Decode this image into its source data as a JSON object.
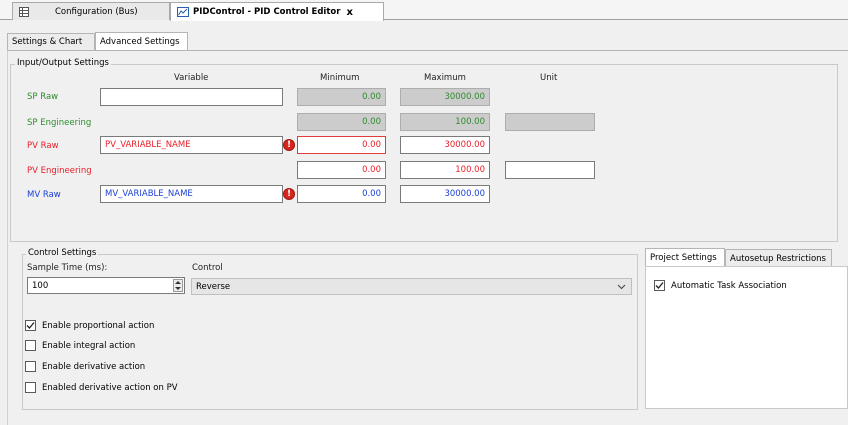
{
  "doc_tabs": [
    {
      "label": "Configuration (Bus)",
      "icon": "grid-config-icon"
    },
    {
      "label": "PIDControl - PID Control Editor",
      "icon": "pid-chart-icon",
      "close": "x"
    }
  ],
  "sub_tabs": [
    "Settings & Chart",
    "Advanced Settings"
  ],
  "io": {
    "title": "Input/Output Settings",
    "headers": {
      "variable": "Variable",
      "minimum": "Minimum",
      "maximum": "Maximum",
      "unit": "Unit"
    },
    "rows": [
      {
        "label": "SP Raw",
        "variable": "",
        "min": "0.00",
        "max": "30000.00",
        "unit": ""
      },
      {
        "label": "SP Engineering",
        "min": "0.00",
        "max": "100.00",
        "unit": ""
      },
      {
        "label": "PV Raw",
        "variable": "PV_VARIABLE_NAME",
        "min": "0.00",
        "max": "30000.00"
      },
      {
        "label": "PV Engineering",
        "min": "0.00",
        "max": "100.00",
        "unit": ""
      },
      {
        "label": "MV Raw",
        "variable": "MV_VARIABLE_NAME",
        "min": "0.00",
        "max": "30000.00"
      }
    ],
    "error_icon": "!"
  },
  "control": {
    "title": "Control Settings",
    "sample_time_label": "Sample Time (ms):",
    "sample_time_value": "100",
    "control_label": "Control",
    "control_value": "Reverse",
    "checkboxes": [
      {
        "label": "Enable proportional action",
        "checked": true
      },
      {
        "label": "Enable integral action",
        "checked": false
      },
      {
        "label": "Enable derivative action",
        "checked": false
      },
      {
        "label": "Enabled derivative action on PV",
        "checked": false
      }
    ]
  },
  "project": {
    "tabs": [
      "Project Settings",
      "Autosetup Restrictions"
    ],
    "auto_task_label": "Automatic Task Association",
    "auto_task_checked": true
  },
  "colors": {
    "sp": "#2e8b2e",
    "pv": "#e8202a",
    "mv": "#1a3fd6"
  }
}
